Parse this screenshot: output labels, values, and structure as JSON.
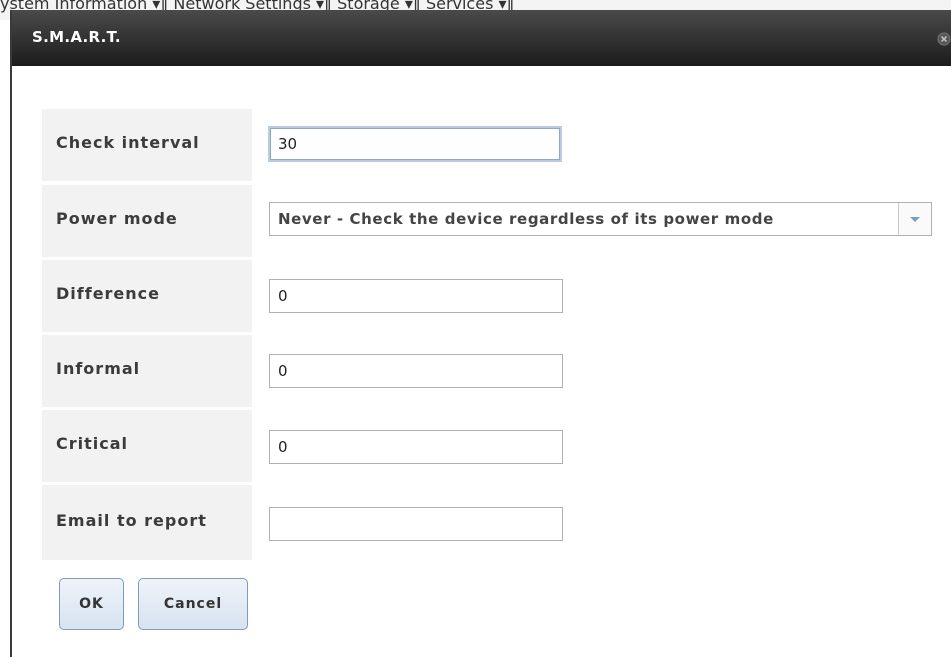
{
  "background": {
    "tabs_text": "ystem Information  ▾‖ Network Settings  ▾‖ Storage  ▾‖ Services  ▾‖"
  },
  "dialog": {
    "title": "S.M.A.R.T."
  },
  "form": {
    "check_interval": {
      "label": "Check interval",
      "value": "30"
    },
    "power_mode": {
      "label": "Power mode",
      "selected": "Never - Check the device regardless of its power mode"
    },
    "difference": {
      "label": "Difference",
      "value": "0"
    },
    "informal": {
      "label": "Informal",
      "value": "0"
    },
    "critical": {
      "label": "Critical",
      "value": "0"
    },
    "email_to_report": {
      "label": "Email to report",
      "value": ""
    }
  },
  "buttons": {
    "ok": "OK",
    "cancel": "Cancel"
  },
  "colors": {
    "titlebar": "#2a2a2a",
    "label_bg": "#f2f2f2",
    "button_border": "#7d9cc0"
  }
}
